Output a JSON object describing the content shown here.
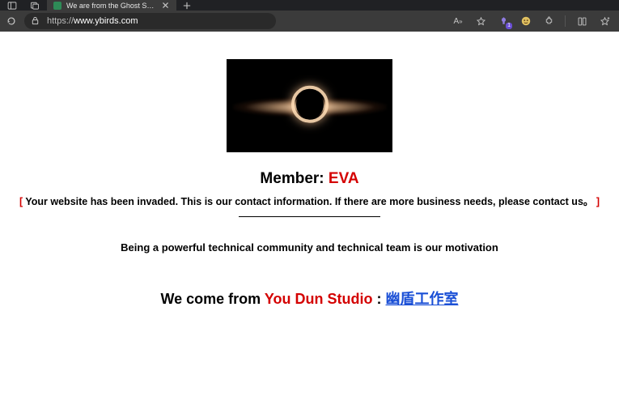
{
  "browser": {
    "tab_title": "We are from the Ghost Shield Ca",
    "url_scheme": "https://",
    "url_host": "www.ybirds.com",
    "badge": "1"
  },
  "page": {
    "member_label": "Member: ",
    "member_name": "EVA",
    "notice_open": "[ ",
    "notice_text": "Your website has been invaded. This is our contact information. If there are more business needs, please contact us。",
    "notice_close": " ]",
    "motivation": "Being a powerful technical community and technical team is our motivation",
    "origin_prefix": "We come from ",
    "origin_studio": "You Dun Studio",
    "origin_sep": " : ",
    "origin_link": "幽盾工作室"
  }
}
